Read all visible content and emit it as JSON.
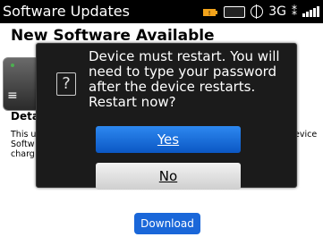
{
  "statusbar": {
    "title": "Software Updates",
    "network": "3G",
    "icons": [
      "battery-warning-icon",
      "lock-icon",
      "globe-icon",
      "bluetooth-icon",
      "signal-icon"
    ]
  },
  "page": {
    "heading": "New Software Available",
    "details_heading": "Deta",
    "description_left": [
      "This u",
      "Softw",
      "charg"
    ],
    "description_right": "evice",
    "download_label": "Download"
  },
  "dialog": {
    "message": "Device must restart.  You will need to type your password after the device restarts. Restart now?",
    "yes_label": "Yes",
    "no_label": "No",
    "icon": "question-icon"
  }
}
